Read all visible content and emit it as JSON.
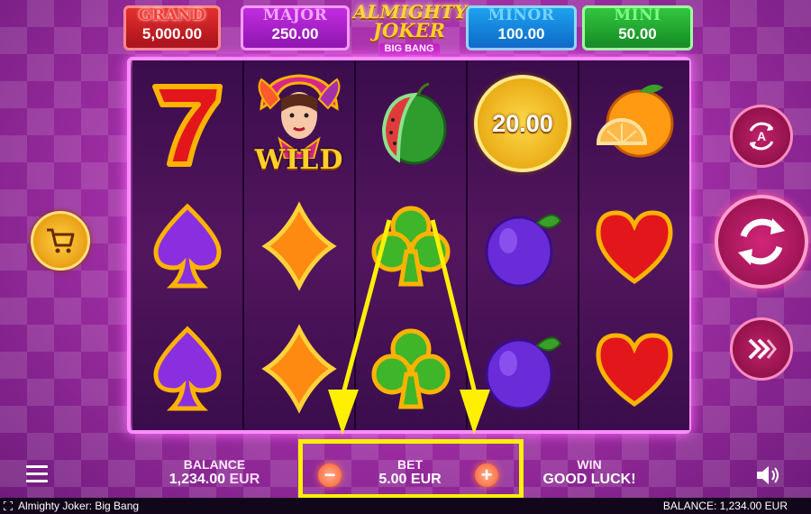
{
  "jackpots": [
    {
      "name": "GRAND",
      "value": "5,000.00"
    },
    {
      "name": "MAJOR",
      "value": "250.00"
    },
    {
      "name": "MINOR",
      "value": "100.00"
    },
    {
      "name": "MINI",
      "value": "50.00"
    }
  ],
  "logo": {
    "line1": "ALMIGHTY",
    "line2": "JOKER",
    "line3": "BIG BANG"
  },
  "reels": {
    "row1": [
      "seven",
      "wild-joker",
      "watermelon",
      "coin",
      "orange"
    ],
    "row2": [
      "spade",
      "diamond",
      "club",
      "plum",
      "heart"
    ],
    "row3": [
      "spade",
      "diamond",
      "club",
      "plum",
      "heart"
    ],
    "wild_label": "WILD",
    "coin_value": "20.00"
  },
  "bottom": {
    "balance_label": "BALANCE",
    "balance_amount": "1,234.00",
    "balance_currency": "EUR",
    "bet_label": "BET",
    "bet_amount": "5.00 EUR",
    "bet_minus": "−",
    "bet_plus": "+",
    "win_label": "WIN",
    "win_text": "GOOD LUCK!"
  },
  "footer": {
    "game_title": "Almighty Joker: Big Bang",
    "balance": "BALANCE: 1,234.00 EUR"
  },
  "colors": {
    "highlight": "#fff000",
    "frame": "#ff8cff"
  }
}
